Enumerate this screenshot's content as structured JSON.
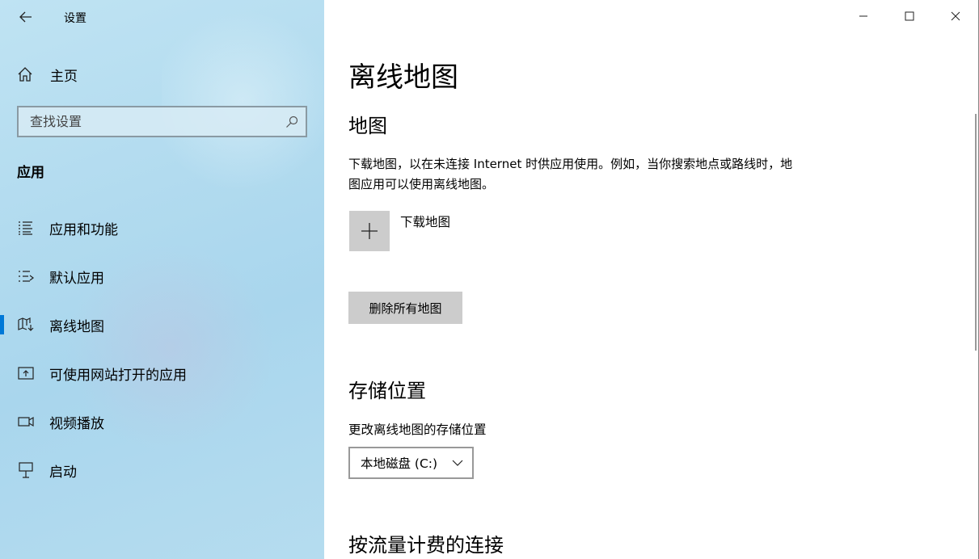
{
  "window": {
    "title": "设置"
  },
  "sidebar": {
    "home_label": "主页",
    "search_placeholder": "查找设置",
    "section_label": "应用",
    "items": [
      {
        "label": "应用和功能",
        "icon": "apps-features-icon"
      },
      {
        "label": "默认应用",
        "icon": "default-apps-icon"
      },
      {
        "label": "离线地图",
        "icon": "offline-maps-icon",
        "active": true
      },
      {
        "label": "可使用网站打开的应用",
        "icon": "apps-for-websites-icon"
      },
      {
        "label": "视频播放",
        "icon": "video-playback-icon"
      },
      {
        "label": "启动",
        "icon": "startup-icon"
      }
    ]
  },
  "main": {
    "title": "离线地图",
    "maps_heading": "地图",
    "maps_desc": "下载地图，以在未连接 Internet 时供应用使用。例如，当你搜索地点或路线时，地图应用可以使用离线地图。",
    "download_label": "下载地图",
    "delete_all_label": "删除所有地图",
    "storage_heading": "存储位置",
    "storage_label": "更改离线地图的存储位置",
    "storage_value": "本地磁盘 (C:)",
    "metered_heading": "按流量计费的连接"
  },
  "colors": {
    "accent": "#0078d7",
    "tile": "#cccccc"
  }
}
